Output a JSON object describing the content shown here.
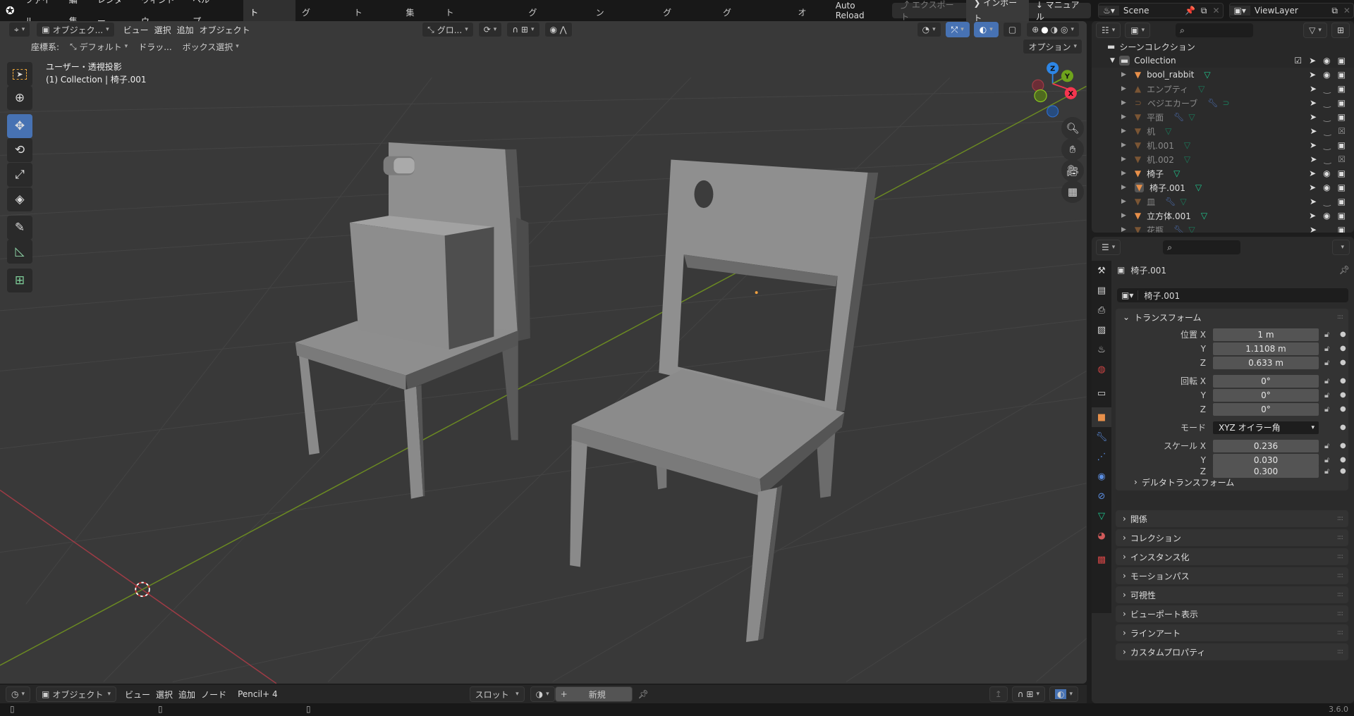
{
  "topbar": {
    "menus": [
      "ファイル",
      "編集",
      "レンダー",
      "ウィンドウ",
      "ヘルプ"
    ],
    "workspaces": [
      "レイアウト",
      "モデリング",
      "スカルプト",
      "UV編集",
      "テクスチャペイント",
      "シェーディング",
      "アニメーション",
      "レンダリング",
      "コンポジティング",
      "ジオ"
    ],
    "active_workspace": "レイアウト",
    "auto_reload": "Auto Reload",
    "export": "エクスポート",
    "import": "インポート",
    "manual": "マニュアル",
    "scene": "Scene",
    "view_layer": "ViewLayer"
  },
  "viewport": {
    "mode": "オブジェク...",
    "menus": [
      "ビュー",
      "選択",
      "追加",
      "オブジェクト"
    ],
    "orientation": "グロ...",
    "coord_label": "座標系:",
    "coord_value": "デフォルト",
    "drag": "ドラッ...",
    "select_mode": "ボックス選択",
    "options": "オプション",
    "view_name": "ユーザー・透視投影",
    "view_info": "(1) Collection | 椅子.001",
    "gizmo_axes": [
      "X",
      "Y",
      "Z"
    ],
    "axis_colors": {
      "x": "#f5364f",
      "y": "#6ea31c",
      "z": "#2d86e6"
    }
  },
  "bottom": {
    "mode": "オブジェクト",
    "menus": [
      "ビュー",
      "選択",
      "追加",
      "ノード"
    ],
    "addon": "Pencil+ 4",
    "slot": "スロット",
    "new": "新規"
  },
  "status": {
    "version": "3.6.0"
  },
  "outliner": {
    "scene_collection": "シーンコレクション",
    "collection": "Collection",
    "items": [
      {
        "name": "bool_rabbit",
        "type": "mesh",
        "dim": false,
        "visible": true,
        "render": true,
        "modifier": false
      },
      {
        "name": "エンプティ",
        "type": "empty-image",
        "dim": true,
        "visible": false,
        "render": true,
        "modifier": false
      },
      {
        "name": "ベジエカーブ",
        "type": "curve",
        "dim": true,
        "visible": false,
        "render": true,
        "modifier": true
      },
      {
        "name": "平面",
        "type": "mesh",
        "dim": true,
        "visible": false,
        "render": true,
        "modifier": true
      },
      {
        "name": "机",
        "type": "mesh",
        "dim": true,
        "visible": false,
        "render": false,
        "modifier": false
      },
      {
        "name": "机.001",
        "type": "mesh",
        "dim": true,
        "visible": false,
        "render": true,
        "modifier": false
      },
      {
        "name": "机.002",
        "type": "mesh",
        "dim": true,
        "visible": false,
        "render": false,
        "modifier": false
      },
      {
        "name": "椅子",
        "type": "mesh",
        "dim": false,
        "visible": true,
        "render": true,
        "modifier": false
      },
      {
        "name": "椅子.001",
        "type": "mesh",
        "dim": false,
        "visible": true,
        "render": true,
        "modifier": false,
        "active": true
      },
      {
        "name": "皿",
        "type": "mesh",
        "dim": true,
        "visible": false,
        "render": true,
        "modifier": true
      },
      {
        "name": "立方体.001",
        "type": "mesh",
        "dim": false,
        "visible": true,
        "render": true,
        "modifier": false
      },
      {
        "name": "花瓶",
        "type": "mesh",
        "dim": true,
        "visible": false,
        "render": true,
        "modifier": true
      }
    ]
  },
  "properties": {
    "object_name": "椅子.001",
    "name_field": "椅子.001",
    "transform": "トランスフォーム",
    "location_label": "位置 X",
    "rotation_label": "回転 X",
    "mode_label": "モード",
    "scale_label": "スケール X",
    "y": "Y",
    "z": "Z",
    "location": [
      "1 m",
      "1.1108 m",
      "0.633 m"
    ],
    "rotation": [
      "0°",
      "0°",
      "0°"
    ],
    "rotation_mode": "XYZ オイラー角",
    "scale": [
      "0.236",
      "0.030",
      "0.300"
    ],
    "delta": "デルタトランスフォーム",
    "panels": [
      "関係",
      "コレクション",
      "インスタンス化",
      "モーションパス",
      "可視性",
      "ビューポート表示",
      "ラインアート",
      "カスタムプロパティ"
    ]
  }
}
